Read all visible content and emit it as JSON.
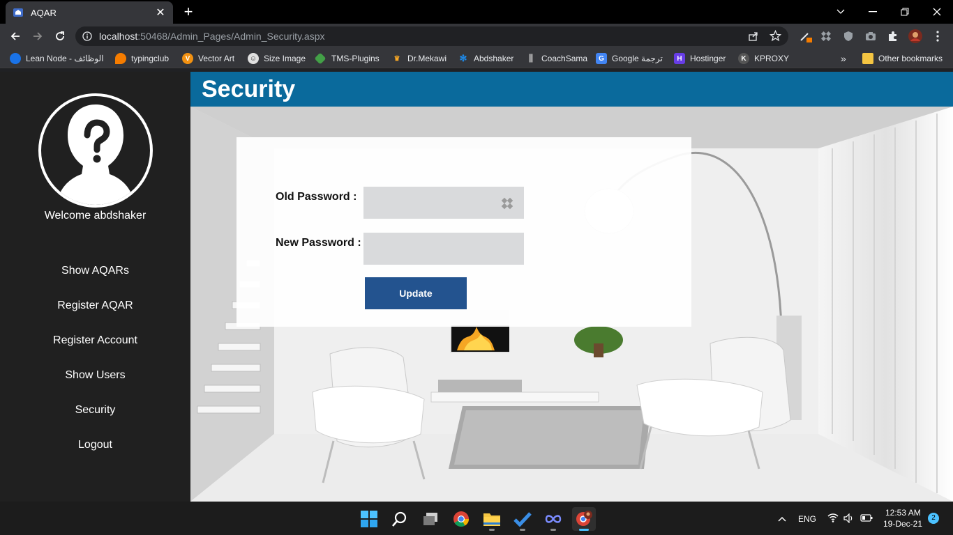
{
  "browser": {
    "tab_title": "AQAR",
    "url_host": "localhost",
    "url_rest": ":50468/Admin_Pages/Admin_Security.aspx",
    "bookmarks": [
      {
        "label": "Lean Node - الوظائف",
        "icon": "globe-icon",
        "color": "#1a73e8"
      },
      {
        "label": "typingclub",
        "icon": "flame-icon",
        "color": "#f57c00"
      },
      {
        "label": "Vector Art",
        "icon": "vector-art-icon",
        "color": "#f29111"
      },
      {
        "label": "Size Image",
        "icon": "size-image-icon",
        "color": "#9e9e9e"
      },
      {
        "label": "TMS-Plugins",
        "icon": "tag-icon",
        "color": "#43a047"
      },
      {
        "label": "Dr.Mekawi",
        "icon": "crown-icon",
        "color": "#f9a825"
      },
      {
        "label": "Abdshaker",
        "icon": "snowflake-icon",
        "color": "#1e88e5"
      },
      {
        "label": "CoachSama",
        "icon": "bars-icon",
        "color": "#9e9e9e"
      },
      {
        "label": "Google ترجمة",
        "icon": "translate-icon",
        "color": "#4285f4"
      },
      {
        "label": "Hostinger",
        "icon": "hostinger-icon",
        "color": "#673de6"
      },
      {
        "label": "KPROXY",
        "icon": "kproxy-icon",
        "color": "#555555"
      }
    ],
    "other_bookmarks": "Other bookmarks",
    "more_bookmarks": "»"
  },
  "sidebar": {
    "welcome": "Welcome abdshaker",
    "items": [
      {
        "label": "Show AQARs"
      },
      {
        "label": "Register AQAR"
      },
      {
        "label": "Register Account"
      },
      {
        "label": "Show Users"
      },
      {
        "label": "Security"
      },
      {
        "label": "Logout"
      }
    ]
  },
  "page": {
    "title": "Security",
    "old_password_label": "Old Password  :",
    "new_password_label": "New Password :",
    "old_password_value": "",
    "new_password_value": "",
    "update_label": "Update"
  },
  "colors": {
    "header": "#0a6a9c",
    "button": "#23538f",
    "sidebar": "#202020"
  },
  "taskbar": {
    "apps": [
      "windows-start-icon",
      "search-icon",
      "task-view-icon",
      "chrome-icon",
      "file-explorer-icon",
      "todo-icon",
      "infinity-icon",
      "chrome-profile-icon"
    ],
    "language": "ENG",
    "time": "12:53 AM",
    "date": "19-Dec-21",
    "notifications": "2"
  }
}
